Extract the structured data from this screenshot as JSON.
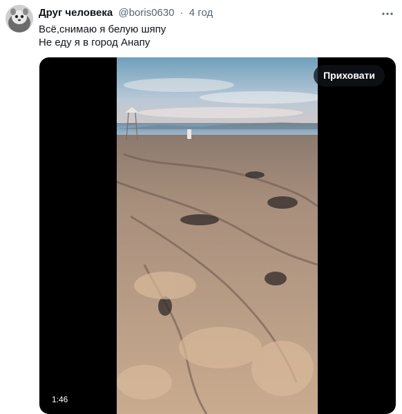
{
  "tweet": {
    "author": {
      "display_name": "Друг человека",
      "handle": "@boris0630",
      "separator": "·",
      "time": "4 год"
    },
    "more_icon": "more-horizontal-icon",
    "text_lines": [
      "Всё,снимаю я белую шяпу",
      "Не еду я в город Анапу"
    ],
    "media": {
      "hide_button_label": "Приховати",
      "duration": "1:46"
    }
  },
  "colors": {
    "text_primary": "#0f1419",
    "text_secondary": "#536471",
    "media_background": "#000000",
    "button_background": "#0f1419"
  }
}
